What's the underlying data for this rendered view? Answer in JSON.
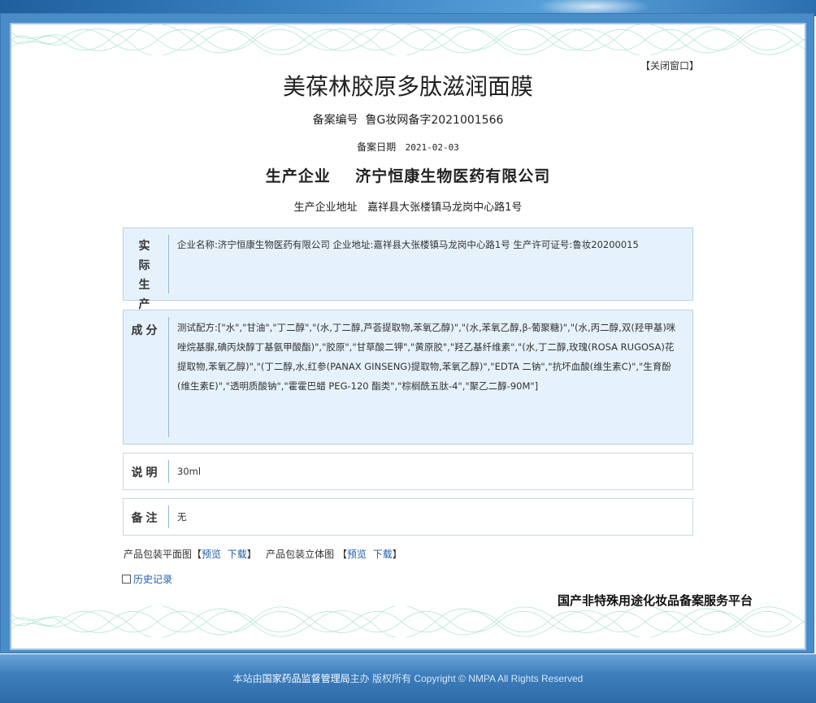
{
  "close_window": "【关闭窗口】",
  "product_title": "美葆林胶原多肽滋润面膜",
  "registration": {
    "label": "备案编号",
    "value": "鲁G妆网备字2021001566"
  },
  "filing_date": {
    "label": "备案日期",
    "value": "2021-02-03"
  },
  "manufacturer": {
    "label": "生产企业",
    "value": "济宁恒康生物医药有限公司"
  },
  "manufacturer_address": {
    "label": "生产企业地址",
    "value": "嘉祥县大张楼镇马龙岗中心路1号"
  },
  "sections": {
    "actual_company": {
      "label": "实际生产企业",
      "text": "企业名称:济宁恒康生物医药有限公司  企业地址:嘉祥县大张楼镇马龙岗中心路1号  生产许可证号:鲁妆20200015"
    },
    "ingredients": {
      "label": "成分",
      "text": "测试配方:[\"水\",\"甘油\",\"丁二醇\",\"(水,丁二醇,芦荟提取物,苯氧乙醇)\",\"(水,苯氧乙醇,β-葡聚糖)\",\"(水,丙二醇,双(羟甲基)咪唑烷基脲,碘丙炔醇丁基氨甲酸酯)\",\"胶原\",\"甘草酸二钾\",\"黄原胶\",\"羟乙基纤维素\",\"(水,丁二醇,玫瑰(ROSA RUGOSA)花提取物,苯氧乙醇)\",\"(丁二醇,水,红参(PANAX GINSENG)提取物,苯氧乙醇)\",\"EDTA 二钠\",\"抗坏血酸(维生素C)\",\"生育酚(维生素E)\",\"透明质酸钠\",\"霍霍巴蜡 PEG-120 酯类\",\"棕榈酰五肽-4\",\"聚乙二醇-90M\"]"
    },
    "description": {
      "label": "说明",
      "text": "30ml"
    },
    "remarks": {
      "label": "备注",
      "text": "无"
    }
  },
  "package": {
    "flat_label": "产品包装平面图",
    "stereo_label": "产品包装立体图",
    "bracket_open": "【",
    "bracket_close": "】",
    "preview": "预览",
    "download": "下载"
  },
  "history_link": "历史记录",
  "platform_name": "国产非特殊用途化妆品备案服务平台",
  "footer": {
    "prefix": "本站由",
    "org": "国家药品监督管理局",
    "suffix": "主办 版权所有 Copyright © NMPA All Rights Reserved"
  }
}
